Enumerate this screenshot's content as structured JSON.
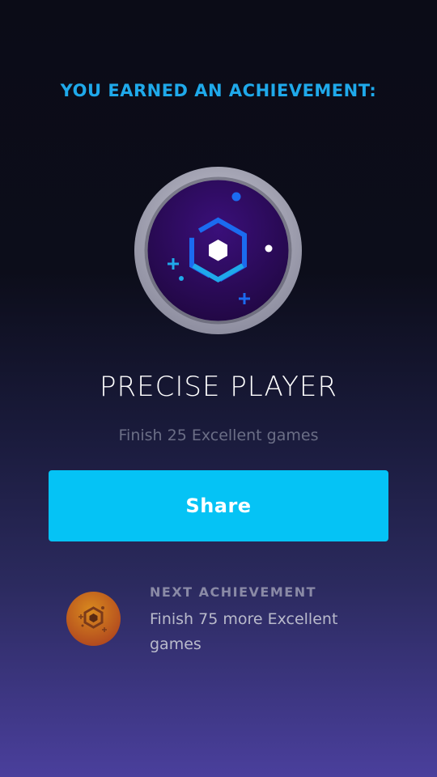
{
  "header": {
    "text": "YOU EARNED AN ACHIEVEMENT:",
    "color": "#1fa9ea"
  },
  "achievement": {
    "icon": "precise-player-badge-icon",
    "title": "PRECISE PLAYER",
    "description": "Finish 25 Excellent games"
  },
  "share_button": {
    "label": "Share",
    "color": "#05c3f5"
  },
  "next_achievement": {
    "icon": "next-achievement-badge-icon",
    "label": "NEXT ACHIEVEMENT",
    "description": "Finish 75 more Excellent games"
  }
}
